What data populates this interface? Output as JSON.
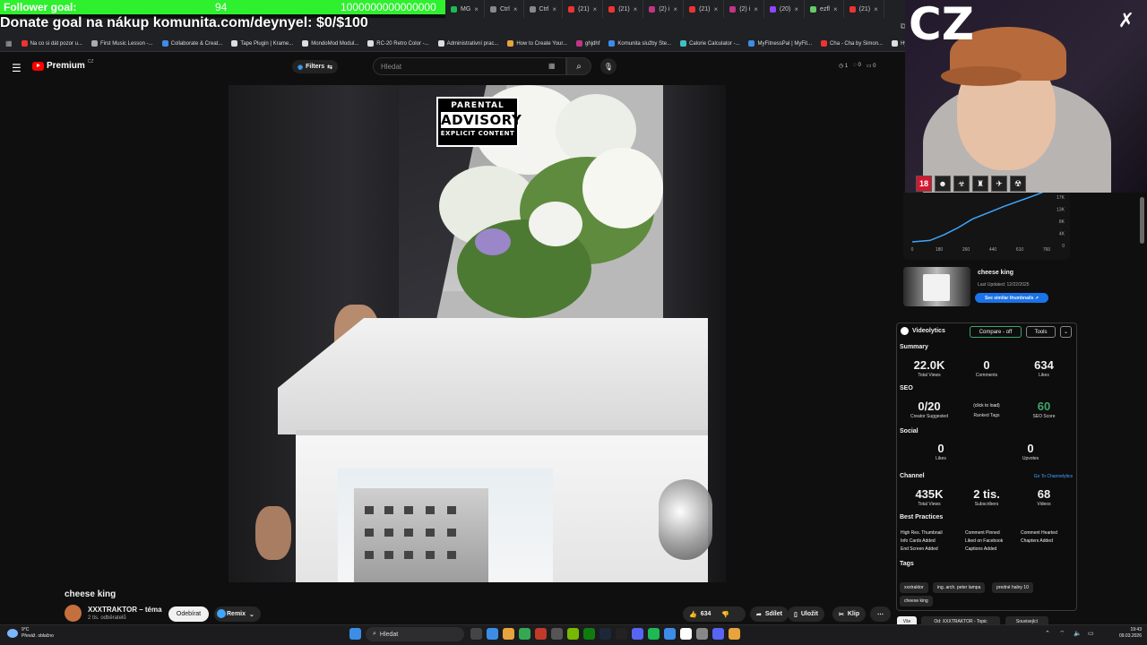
{
  "overlay": {
    "follower_goal_label": "Follower goal:",
    "follower_current": "94",
    "follower_target": "1000000000000000",
    "donate_text": "Donate goal na nákup komunita.com/deynyel: $0/$100"
  },
  "browser": {
    "tabs": [
      "MG",
      "Ctrl",
      "Ctrl",
      "(21)",
      "(21)",
      "(2) i",
      "(21)",
      "(2) i",
      "(20)",
      "ezfl",
      "(21)"
    ],
    "bookmarks": [
      "Na co si dát pozor u...",
      "First Music Lesson -...",
      "Collaborate & Creat...",
      "Tape Plugin | Krame...",
      "MondoMod Modul...",
      "RC-20 Retro Color -...",
      "Administrativní prac...",
      "How to Create Your...",
      "ghjdhf",
      "Komunita služby Ste...",
      "Calorie Calculator -...",
      "MyFitnessPal | MyFit...",
      "Cha - Cha by Simon...",
      "Hyp"
    ]
  },
  "youtube": {
    "logo_text": "Premium",
    "country": "CZ",
    "filters_label": "Filters",
    "search_placeholder": "Hledat",
    "header_stats": [
      "1",
      "0",
      "0"
    ]
  },
  "cover": {
    "pa_line1": "PARENTAL",
    "pa_line2": "ADVISORY",
    "pa_line3": "EXPLICIT CONTENT"
  },
  "video": {
    "title": "cheese king",
    "channel": "XXXTRAKTOR – téma",
    "subscribers": "2 tis. odběratelů",
    "unsubscribe_label": "Odebírat",
    "remix_label": "Remix",
    "like_count": "634",
    "share_label": "Sdílet",
    "save_label": "Uložit",
    "clip_label": "Klip"
  },
  "analytics_chart": {
    "y_ticks": [
      "17K",
      "13K",
      "8K",
      "4K",
      "0"
    ],
    "x_ticks": [
      "0",
      "180",
      "260",
      "440",
      "610",
      "760"
    ]
  },
  "chart_data": {
    "type": "line",
    "title": "",
    "xlabel": "",
    "ylabel": "",
    "x": [
      0,
      100,
      180,
      260,
      340,
      440,
      520,
      610,
      700,
      760
    ],
    "values": [
      0,
      500,
      2500,
      5000,
      8000,
      10500,
      12500,
      14500,
      16500,
      18000
    ],
    "xlim": [
      0,
      760
    ],
    "ylim": [
      0,
      17000
    ]
  },
  "thumb_card": {
    "title": "cheese king",
    "updated": "Last Updated: 12/22/2025",
    "similar_button": "See similar thumbnails ↗"
  },
  "videolytics": {
    "name": "Videolytics",
    "compare_label": "Compare - off",
    "tools_label": "Tools",
    "summary_heading": "Summary",
    "summary": [
      {
        "value": "22.0K",
        "label": "Total Views"
      },
      {
        "value": "0",
        "label": "Comments"
      },
      {
        "value": "634",
        "label": "Likes"
      }
    ],
    "seo_heading": "SEO",
    "seo": [
      {
        "value": "0/20",
        "label": "Creator Suggested"
      },
      {
        "value": "(click to load)",
        "label": "Ranked Tags"
      },
      {
        "value": "60",
        "label": "SEO Score"
      }
    ],
    "social_heading": "Social",
    "social": [
      {
        "value": "0",
        "label": "Likes"
      },
      {
        "value": "0",
        "label": "Upvotes"
      }
    ],
    "channel_heading": "Channel",
    "channel_link": "Go To Channelytics",
    "channel": [
      {
        "value": "435K",
        "label": "Total Views"
      },
      {
        "value": "2 tis.",
        "label": "Subscribers"
      },
      {
        "value": "68",
        "label": "Videos"
      }
    ],
    "best_heading": "Best Practices",
    "best": [
      "High Res. Thumbnail",
      "Comment Pinned",
      "Comment Hearted",
      "Info Cards Added",
      "Liked on Facebook",
      "Chapters Added",
      "End Screen Added",
      "Captions Added"
    ],
    "tags_heading": "Tags",
    "tags": [
      "xxxtraktor",
      "ing. arch. peter lampa",
      "predné halny 10",
      "cheese king"
    ]
  },
  "related_pills": [
    "Vše",
    "Od: XXXTRAKTOR - Topic",
    "Související"
  ],
  "webcam": {
    "overlay_text": "CZ",
    "emotes": [
      "18",
      "☻",
      "☣",
      "♜",
      "✈",
      "☢"
    ]
  },
  "taskbar": {
    "weather_temp": "9°C",
    "weather_desc": "Převáž. oblačno",
    "search_label": "Hledat",
    "time": "19:43",
    "date": "09.03.2026"
  }
}
